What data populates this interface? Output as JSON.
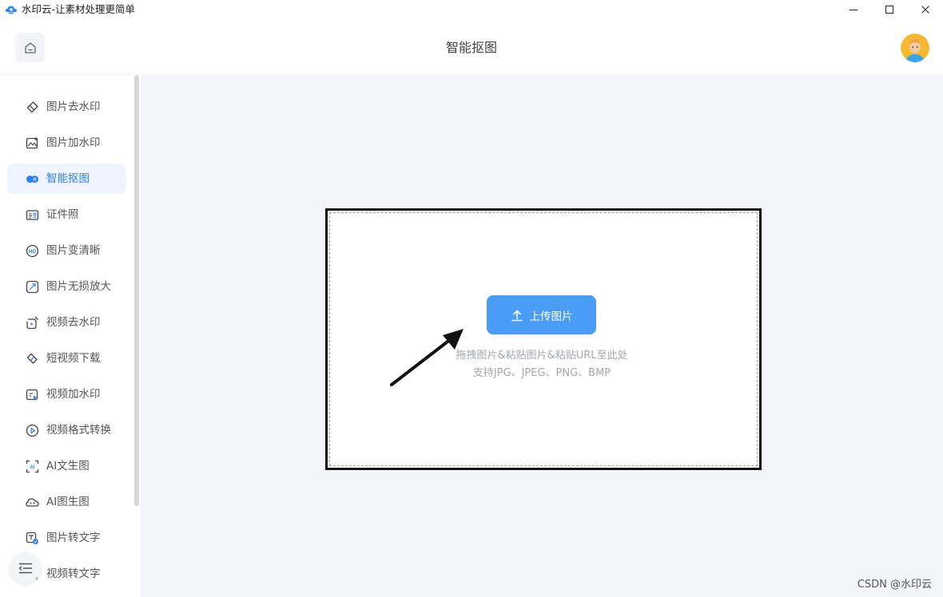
{
  "window": {
    "title": "水印云-让素材处理更简单",
    "controls": [
      "minimize",
      "maximize",
      "close"
    ]
  },
  "header": {
    "title": "智能抠图",
    "home_icon": "home-icon",
    "avatar_icon": "user-avatar"
  },
  "sidebar": {
    "active_index": 2,
    "items": [
      {
        "label": "图片去水印",
        "icon": "eraser-icon"
      },
      {
        "label": "图片加水印",
        "icon": "image-add-icon"
      },
      {
        "label": "智能抠图",
        "icon": "cutout-icon"
      },
      {
        "label": "证件照",
        "icon": "id-card-icon"
      },
      {
        "label": "图片变清晰",
        "icon": "hd-icon"
      },
      {
        "label": "图片无损放大",
        "icon": "enlarge-icon"
      },
      {
        "label": "视频去水印",
        "icon": "video-eraser-icon"
      },
      {
        "label": "短视频下载",
        "icon": "link-icon"
      },
      {
        "label": "视频加水印",
        "icon": "video-add-icon"
      },
      {
        "label": "视频格式转换",
        "icon": "play-circle-icon"
      },
      {
        "label": "AI文生图",
        "icon": "ai-text-icon"
      },
      {
        "label": "AI图生图",
        "icon": "ai-image-icon"
      },
      {
        "label": "图片转文字",
        "icon": "ocr-icon"
      },
      {
        "label": "视频转文字",
        "icon": "video-text-icon"
      }
    ],
    "collapse_icon": "menu-collapse-icon"
  },
  "upload": {
    "button_label": "上传图片",
    "hint_line1": "拖拽图片&粘贴图片&粘贴URL至此处",
    "hint_line2": "支持JPG、JPEG、PNG、BMP"
  },
  "watermark": "CSDN @水印云",
  "colors": {
    "accent": "#4a9cf7",
    "active_text": "#2f7ff0",
    "main_bg": "#f3f5fa"
  }
}
